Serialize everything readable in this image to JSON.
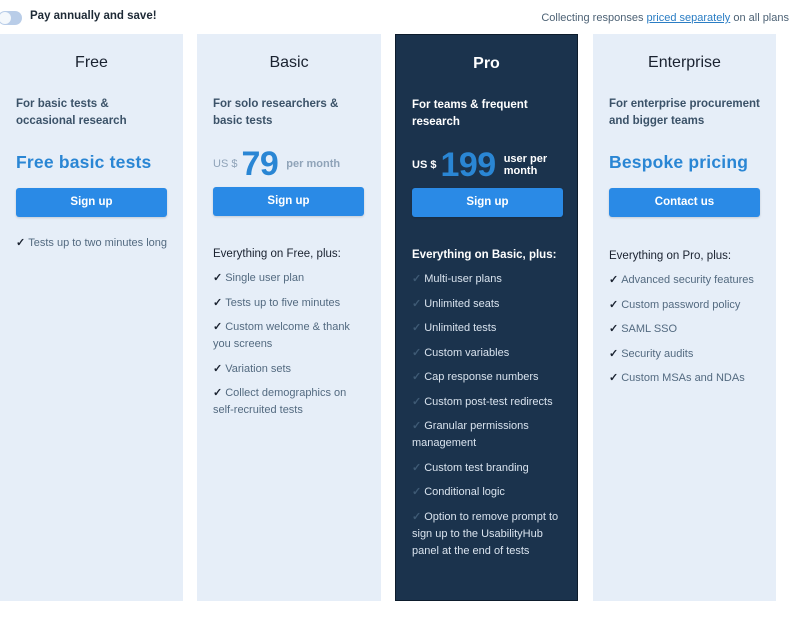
{
  "header": {
    "toggle_label": "Pay annually and save!",
    "toggle_on": false,
    "collect_prefix": "Collecting responses ",
    "collect_link": "priced separately",
    "collect_suffix": " on all plans"
  },
  "colors": {
    "accent": "#2a8ae6",
    "price_blue": "#2a86d4",
    "card_bg": "#e6eef8",
    "pro_bg": "#1b334d"
  },
  "check_icon": "✓",
  "plans": [
    {
      "name": "Free",
      "description": "For basic tests & occasional research",
      "price_text": "Free basic tests",
      "button": "Sign up",
      "plus_title": "",
      "features": [
        "Tests up to two minutes long"
      ]
    },
    {
      "name": "Basic",
      "description": "For solo researchers & basic tests",
      "currency": "US $",
      "amount": "79",
      "period": "per month",
      "button": "Sign up",
      "plus_title": "Everything on Free, plus:",
      "features": [
        "Single user plan",
        "Tests up to five minutes",
        "Custom welcome & thank you screens",
        "Variation sets",
        "Collect demographics on self-recruited tests"
      ]
    },
    {
      "name": "Pro",
      "description": "For teams & frequent research",
      "currency": "US $",
      "amount": "199",
      "period": "user per month",
      "button": "Sign up",
      "plus_title": "Everything on Basic, plus:",
      "features": [
        "Multi-user plans",
        "Unlimited seats",
        "Unlimited tests",
        "Custom variables",
        "Cap response numbers",
        "Custom post-test redirects",
        "Granular permissions management",
        "Custom test branding",
        "Conditional logic",
        "Option to remove prompt to sign up to the UsabilityHub panel at the end of tests"
      ]
    },
    {
      "name": "Enterprise",
      "description": "For enterprise procurement and bigger teams",
      "price_text": "Bespoke pricing",
      "button": "Contact us",
      "plus_title": "Everything on Pro, plus:",
      "features": [
        "Advanced security features",
        "Custom password policy",
        "SAML SSO",
        "Security audits",
        "Custom MSAs and NDAs"
      ]
    }
  ]
}
